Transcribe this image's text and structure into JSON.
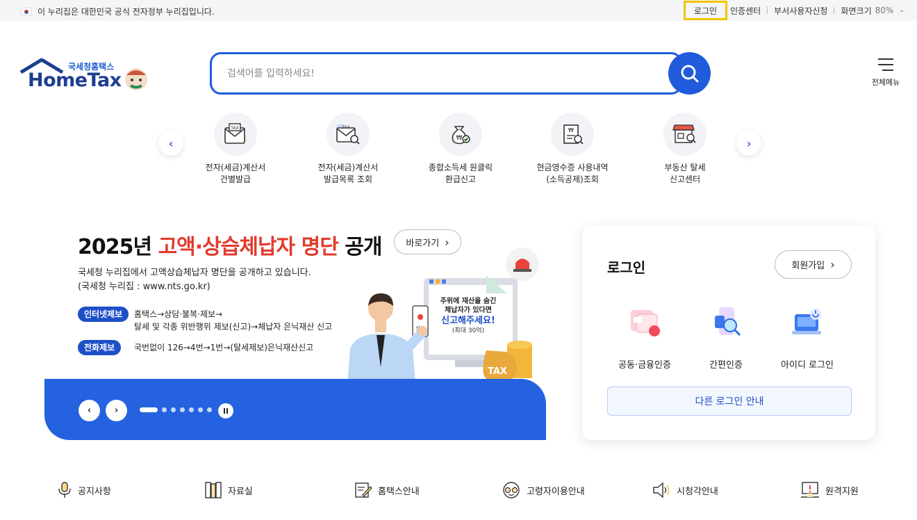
{
  "topbar": {
    "gov_notice": "이 누리집은 대한민국 공식 전자정부 누리집입니다.",
    "login": "로그인",
    "cert_center": "인증센터",
    "dept_apply": "부서사용자신청",
    "zoom_label": "화면크기",
    "zoom_value": "80%"
  },
  "logo": {
    "sub": "국세청홈택스",
    "main": "HomeTax"
  },
  "search": {
    "placeholder": "검색어를 입력하세요!"
  },
  "allmenu": {
    "label": "전체메뉴"
  },
  "quick_menu": [
    {
      "line1": "전자(세금)계산서",
      "line2": "건별발급"
    },
    {
      "line1": "전자(세금)계산서",
      "line2": "발급목록 조회"
    },
    {
      "line1": "종합소득세 원클릭",
      "line2": "환급신고"
    },
    {
      "line1": "현금영수증 사용내역",
      "line2": "(소득공제)조회"
    },
    {
      "line1": "부동산 탈세",
      "line2": "신고센터"
    }
  ],
  "banner": {
    "title_year": "2025년",
    "title_highlight": "고액·상습체납자 명단",
    "title_end": "공개",
    "goto": "바로가기",
    "desc1": "국세청 누리집에서 고액상습체납자 명단을 공개하고 있습니다.",
    "desc2": "(국세청 누리집 : www.nts.go.kr)",
    "tag1": "인터넷제보",
    "tag1_text1": "홈택스→상담·불복·제보→",
    "tag1_text2": "탈세 및 각종 위반행위 제보(신고)→체납자 은닉재산 신고",
    "tag2": "전화제보",
    "tag2_text": "국번없이 126→4번→1번→(탈세제보)은닉재산신고",
    "screen_line1": "주위에 재산을 숨긴",
    "screen_line2": "체납자가 있다면",
    "screen_line3": "신고해주세요!",
    "screen_line4": "(최대 30억)",
    "phone_label": "신고",
    "coin_label": "TAX"
  },
  "login_card": {
    "title": "로그인",
    "join": "회원가입",
    "methods": [
      "공동·금융인증",
      "간편인증",
      "아이디 로그인"
    ],
    "other": "다른 로그인 안내"
  },
  "bottom_links": [
    "공지사항",
    "자료실",
    "홈택스안내",
    "고령자이용안내",
    "시청각안내",
    "원격지원"
  ],
  "colors": {
    "primary": "#1f5bdb",
    "highlight": "#e23a2c",
    "focus": "#f5c400"
  }
}
